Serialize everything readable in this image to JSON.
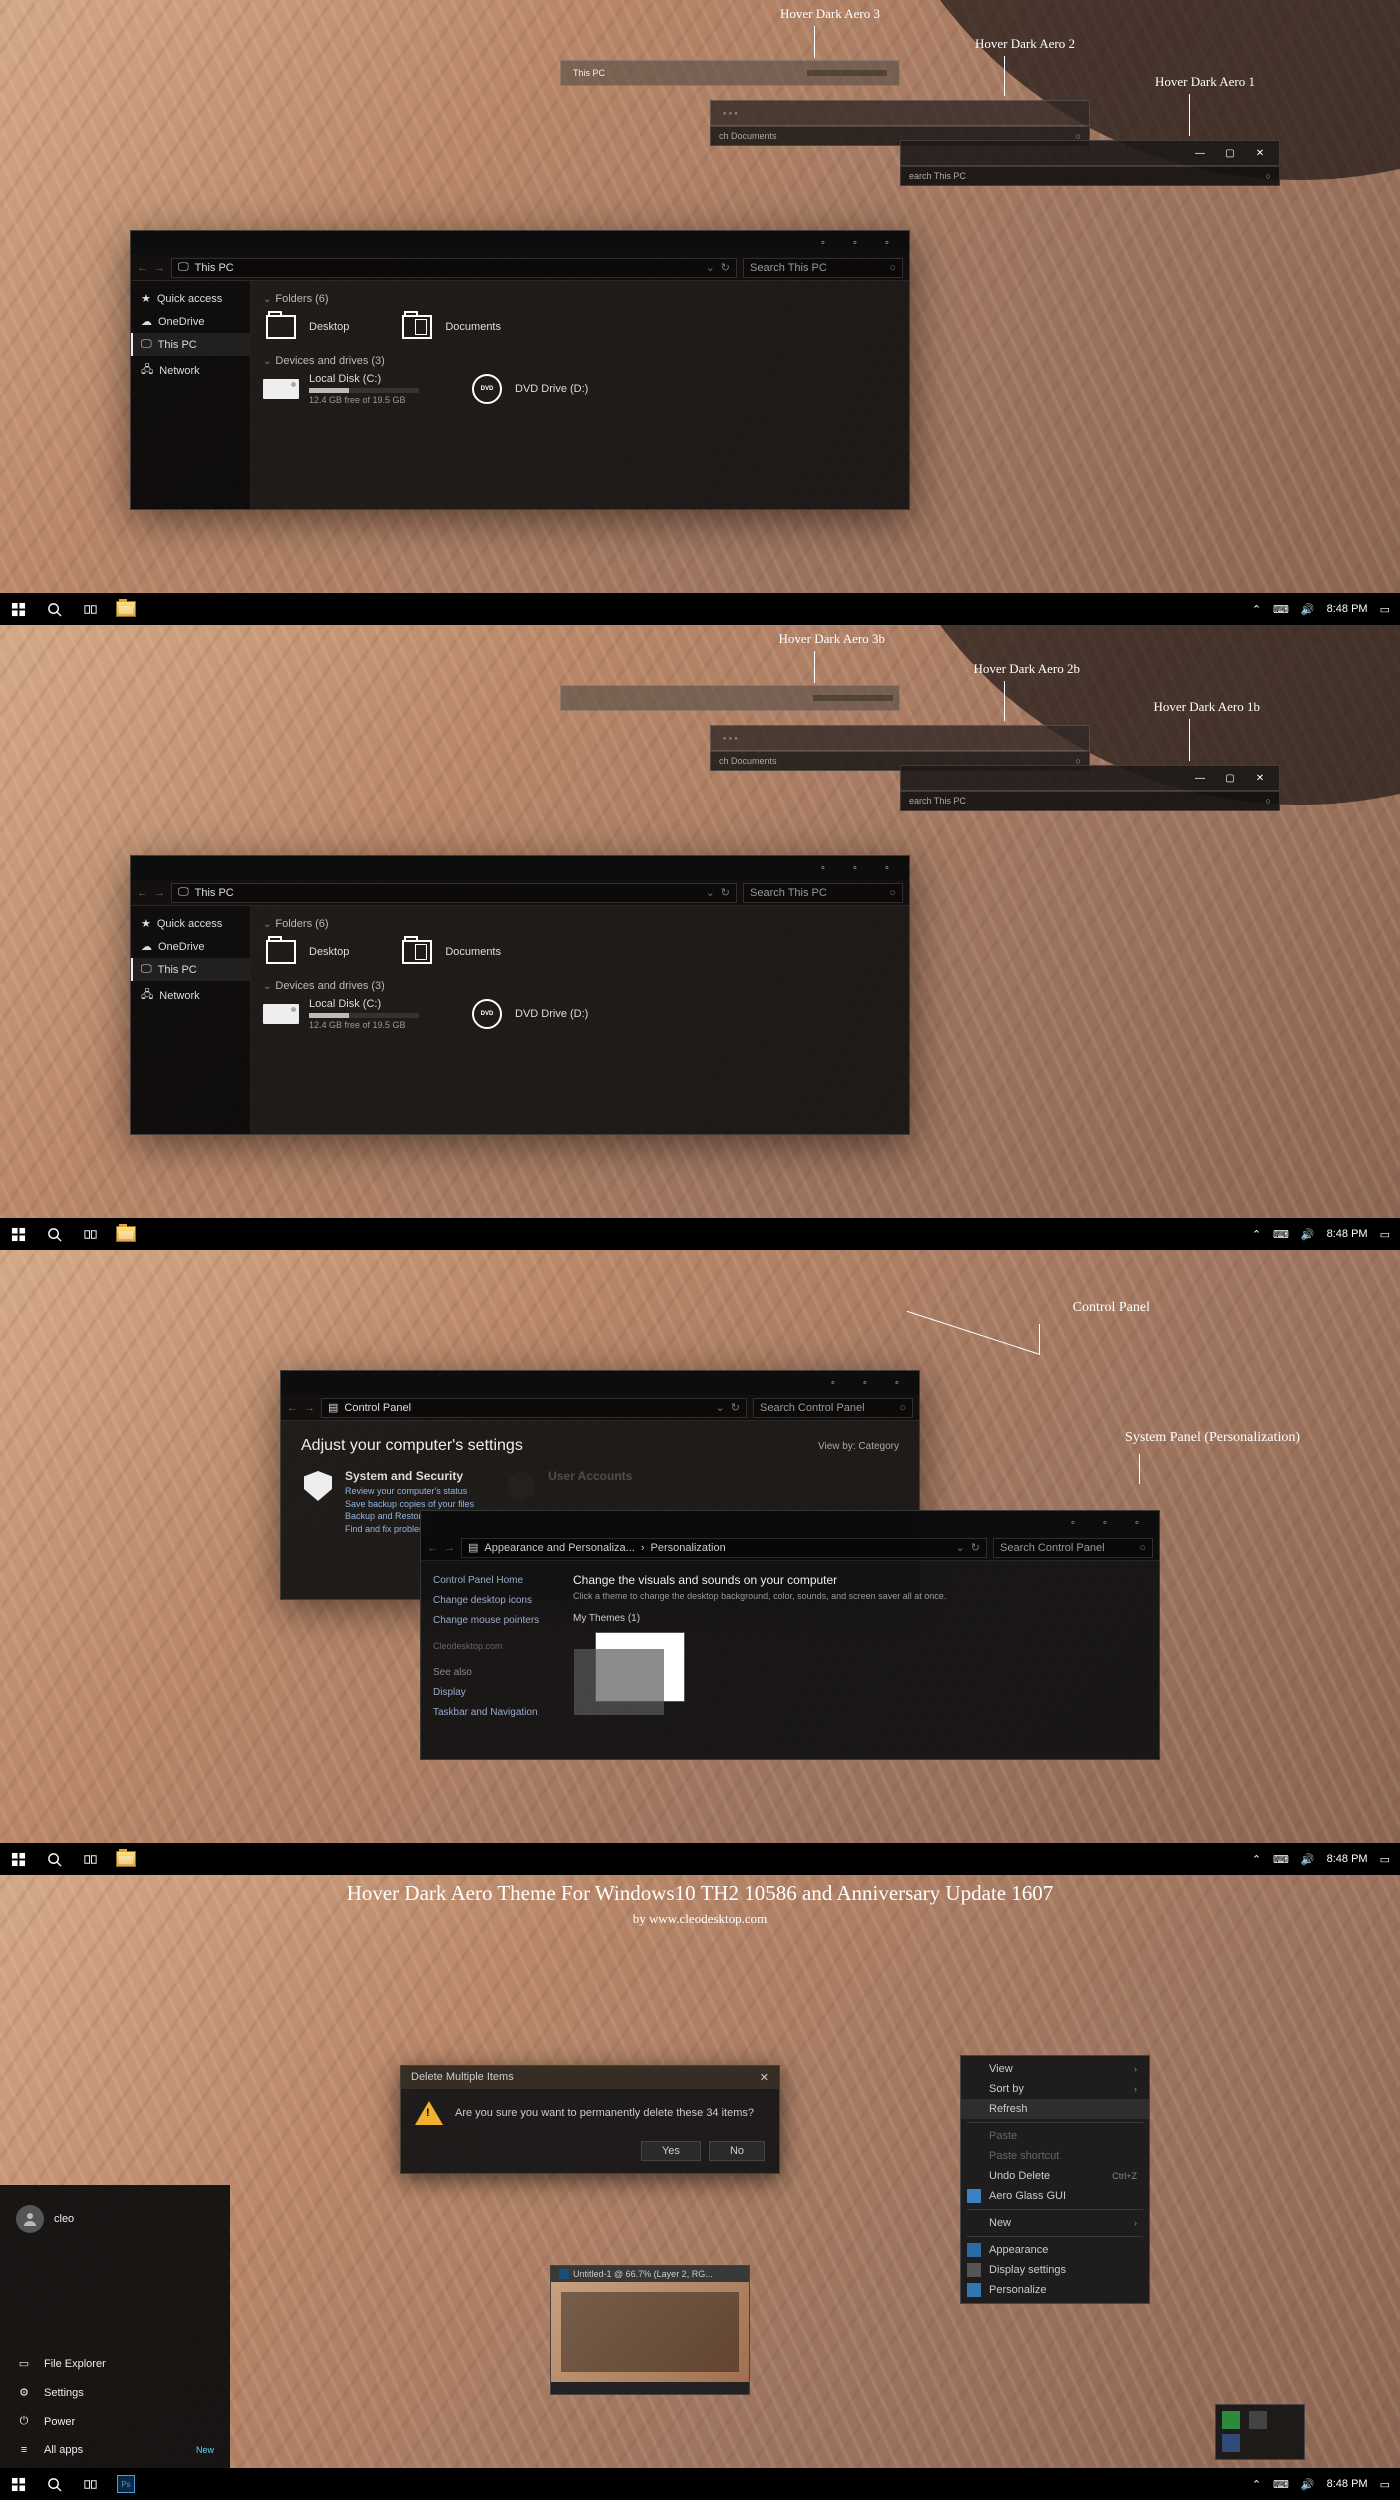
{
  "explorer": {
    "title": "This PC",
    "search": "Search This PC",
    "nav": {
      "quick": "Quick access",
      "onedrive": "OneDrive",
      "thispc": "This PC",
      "network": "Network"
    },
    "folders_head": "Folders (6)",
    "drives_head": "Devices and drives (3)",
    "folder_desktop": "Desktop",
    "folder_documents": "Documents",
    "drive_c": "Local Disk (C:)",
    "drive_c_sub": "12.4 GB free of 19.5 GB",
    "drive_dvd": "DVD Drive (D:)"
  },
  "variants_a": {
    "v3": "Hover Dark Aero 3",
    "v2": "Hover Dark Aero 2",
    "v1": "Hover Dark Aero 1"
  },
  "variants_b": {
    "v3": "Hover Dark Aero 3b",
    "v2": "Hover Dark Aero 2b",
    "v1": "Hover Dark Aero 1b"
  },
  "variant_search2": "ch Documents",
  "variant_search1": "earch This PC",
  "taskbar": {
    "time": "8:48 PM"
  },
  "cp": {
    "title": "Control Panel",
    "search": "Search Control Panel",
    "heading": "Adjust your computer's settings",
    "viewby": "View by:   Category",
    "cat1": {
      "title": "System and Security",
      "l1": "Review your computer's status",
      "l2": "Save backup copies of your files",
      "l3": "Backup and Restore",
      "l4": "Find and fix problems"
    },
    "cat2": {
      "title": "User Accounts"
    },
    "callout_cp": "Control Panel",
    "callout_pz": "System Panel (Personalization)"
  },
  "pz": {
    "crumb1": "Appearance and Personaliza...",
    "crumb2": "Personalization",
    "search": "Search Control Panel",
    "side": {
      "home": "Control Panel Home",
      "icons": "Change desktop icons",
      "mouse": "Change mouse pointers",
      "seealso": "See also",
      "display": "Display",
      "tbnav": "Taskbar and Navigation"
    },
    "main_h": "Change the visuals and sounds on your computer",
    "main_sub": "Click a theme to change the desktop background, color, sounds, and screen saver all at once.",
    "mythemes": "My Themes (1)",
    "watermark": "Cleodesktop.com"
  },
  "p4": {
    "title": "Hover Dark Aero Theme For Windows10 TH2 10586 and Anniversary Update 1607",
    "byline": "by www.cleodesktop.com",
    "user": "cleo",
    "start": {
      "fe": "File Explorer",
      "settings": "Settings",
      "power": "Power",
      "allapps": "All apps",
      "new": "New"
    },
    "dialog": {
      "title": "Delete Multiple Items",
      "msg": "Are you sure you want to permanently delete these 34 items?",
      "yes": "Yes",
      "no": "No"
    },
    "ctx": {
      "view": "View",
      "sortby": "Sort by",
      "refresh": "Refresh",
      "paste": "Paste",
      "pastesc": "Paste shortcut",
      "undo": "Undo Delete",
      "undok": "Ctrl+Z",
      "aero": "Aero Glass GUI",
      "new": "New",
      "appearance": "Appearance",
      "disp": "Display settings",
      "pers": "Personalize"
    },
    "ps": {
      "tab": "Untitled-1 @ 66.7% (Layer 2, RG..."
    }
  }
}
